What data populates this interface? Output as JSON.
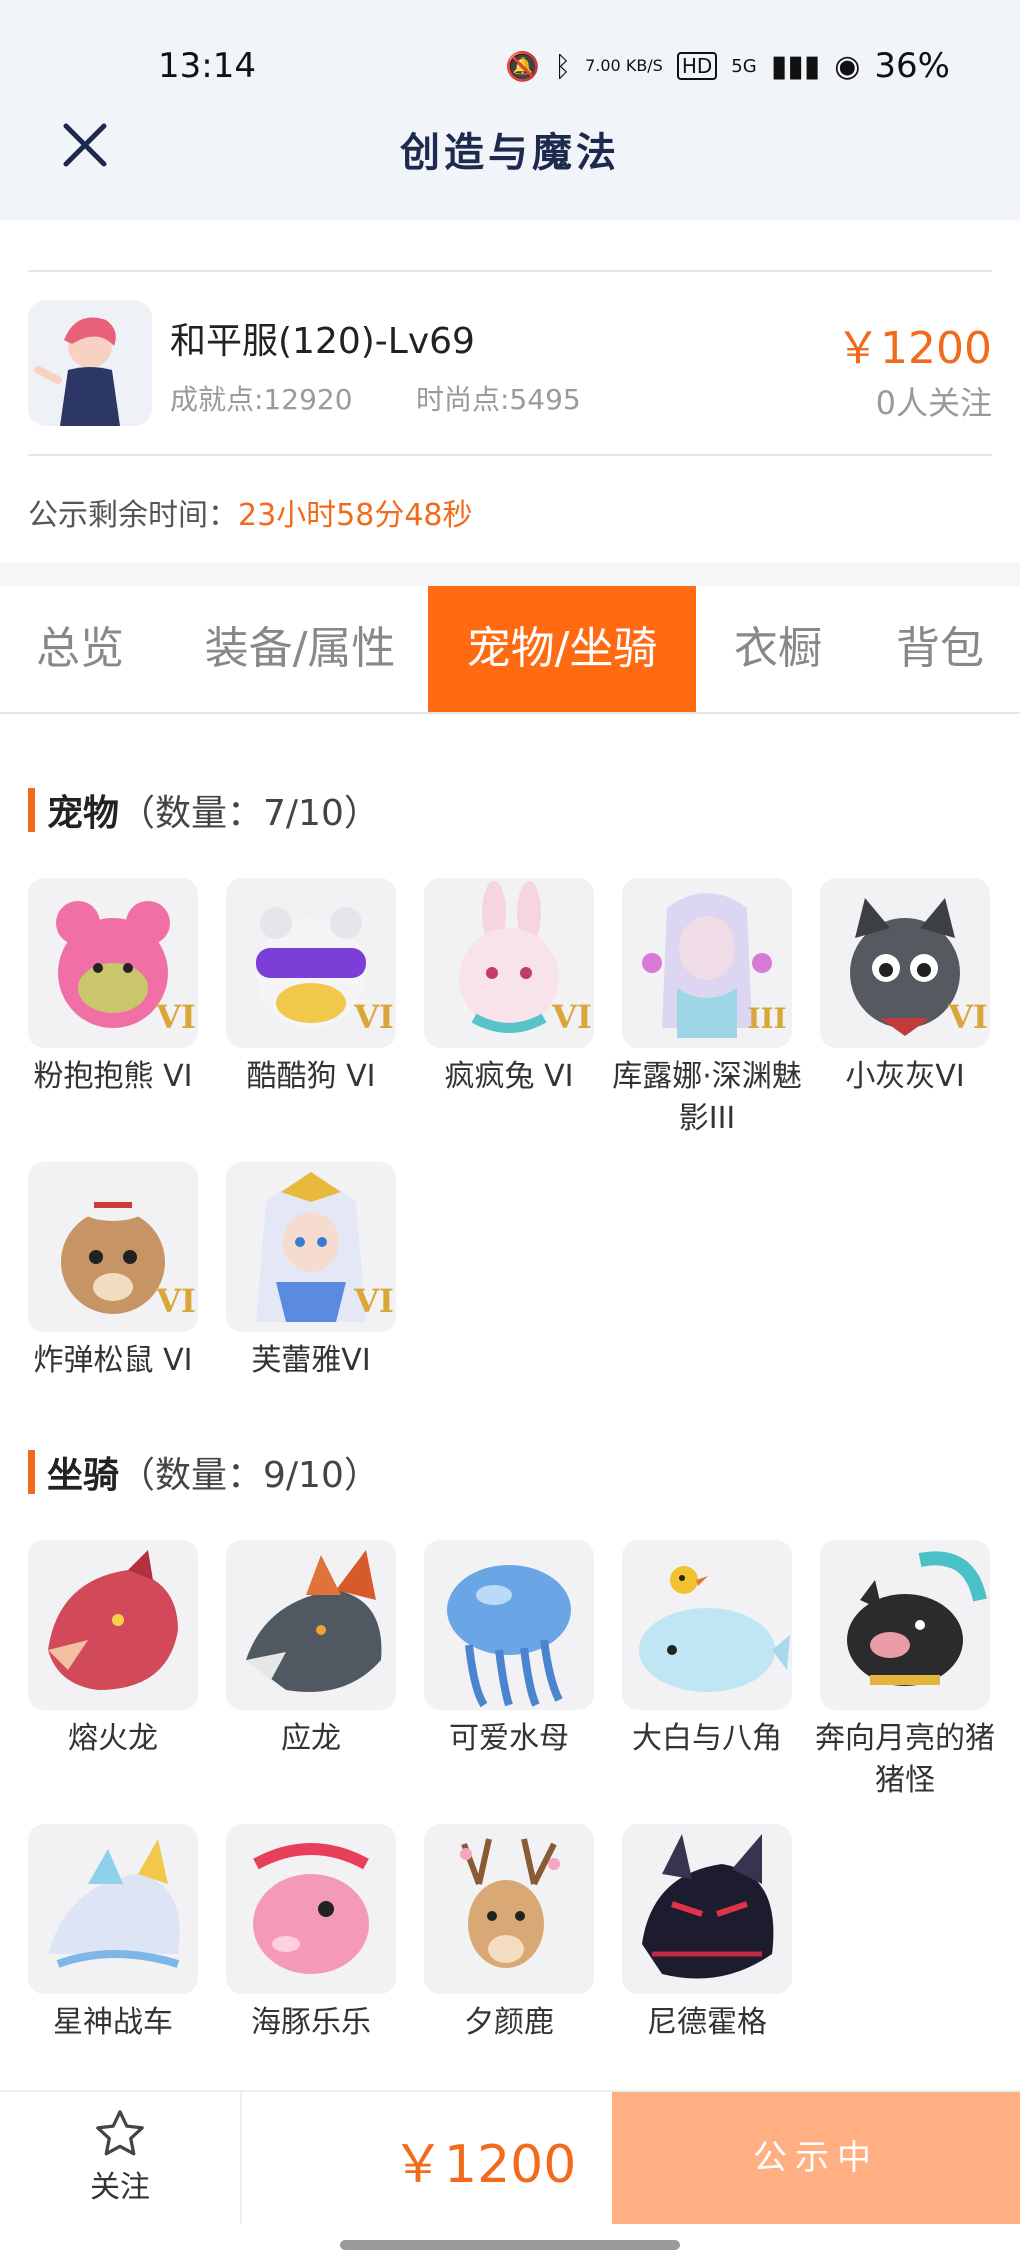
{
  "status_bar": {
    "time": "13:14",
    "net_speed": "7.00 KB/S",
    "hd": "HD",
    "signal": "5G",
    "battery": "36%"
  },
  "header": {
    "title": "创造与魔法"
  },
  "item": {
    "name": "和平服(120)-Lv69",
    "achievement": "成就点:12920",
    "fashion": "时尚点:5495",
    "price": "￥1200",
    "followers": "0人关注"
  },
  "timer": {
    "label": "公示剩余时间：",
    "value": "23小时58分48秒"
  },
  "tabs": [
    "总览",
    "装备/属性",
    "宠物/坐骑",
    "衣橱",
    "背包"
  ],
  "active_tab": 2,
  "pets": {
    "name": "宠物",
    "count": "（数量：7/10）",
    "items": [
      "粉抱抱熊 VI",
      "酷酷狗 VI",
      "疯疯兔 VI",
      "库露娜·深渊魅影III",
      "小灰灰VI",
      "炸弹松鼠 VI",
      "芙蕾雅VI"
    ]
  },
  "mounts": {
    "name": "坐骑",
    "count": "（数量：9/10）",
    "items": [
      "熔火龙",
      "应龙",
      "可爱水母",
      "大白与八角",
      "奔向月亮的猪猪怪",
      "星神战车",
      "海豚乐乐",
      "夕颜鹿",
      "尼德霍格"
    ]
  },
  "bottom": {
    "follow_label": "关注",
    "price": "￥1200",
    "status_button": "公示中"
  },
  "colors": {
    "accent": "#ff6a12",
    "price": "#f26b1d",
    "button_disabled": "#ffaf82"
  }
}
